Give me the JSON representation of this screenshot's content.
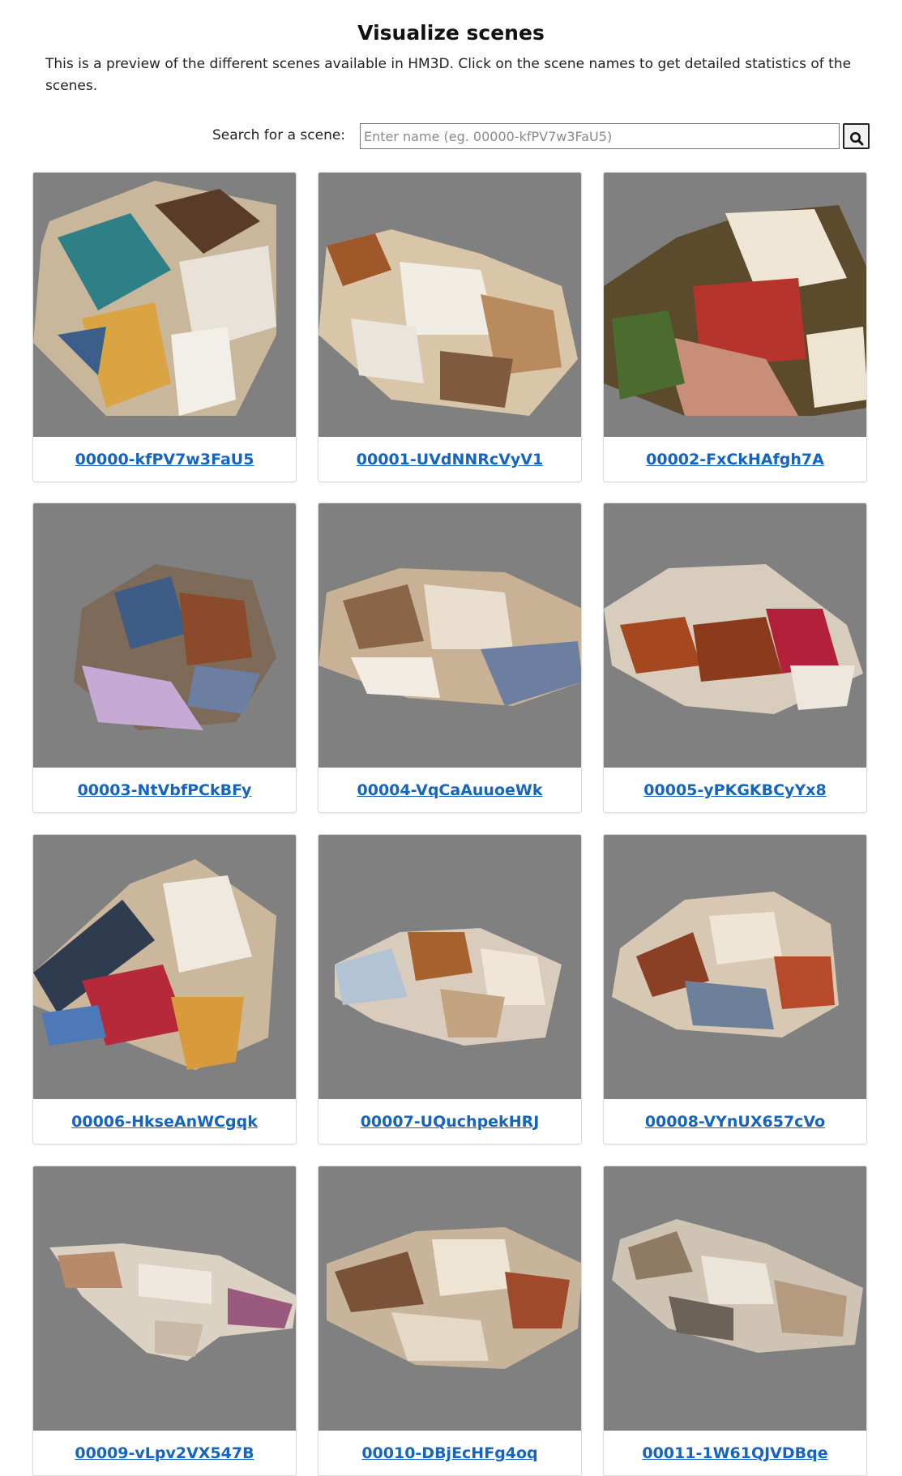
{
  "page": {
    "title": "Visualize scenes",
    "intro": "This is a preview of the different scenes available in HM3D. Click on the scene names to get detailed statistics of the scenes."
  },
  "search": {
    "label": "Search for a scene:",
    "placeholder": "Enter name (eg. 00000-kfPV7w3FaU5)",
    "value": "",
    "button_icon": "search-icon"
  },
  "colors": {
    "link": "#1565c0",
    "thumbnail_background": "#808080"
  },
  "scenes": [
    {
      "name": "00000-kfPV7w3FaU5"
    },
    {
      "name": "00001-UVdNNRcVyV1"
    },
    {
      "name": "00002-FxCkHAfgh7A"
    },
    {
      "name": "00003-NtVbfPCkBFy"
    },
    {
      "name": "00004-VqCaAuuoeWk"
    },
    {
      "name": "00005-yPKGKBCyYx8"
    },
    {
      "name": "00006-HkseAnWCgqk"
    },
    {
      "name": "00007-UQuchpekHRJ"
    },
    {
      "name": "00008-VYnUX657cVo"
    },
    {
      "name": "00009-vLpv2VX547B"
    },
    {
      "name": "00010-DBjEcHFg4oq"
    },
    {
      "name": "00011-1W61QJVDBqe"
    }
  ]
}
